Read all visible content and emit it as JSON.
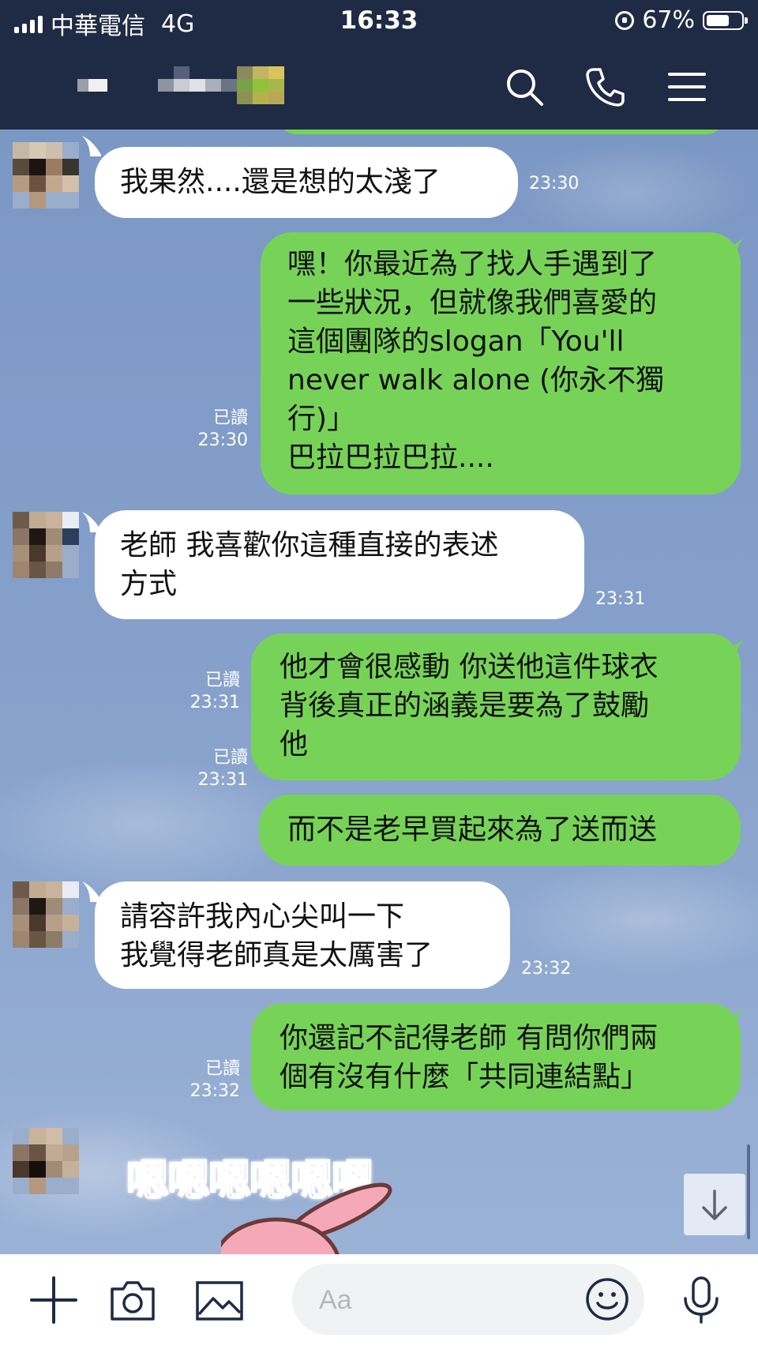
{
  "status_bar": {
    "carrier": "中華電信",
    "network": "4G",
    "time": "16:33",
    "battery": "67%",
    "battery_level": 0.67
  },
  "header": {
    "contact_name_obscured": true,
    "icons": [
      "search-icon",
      "phone-icon",
      "menu-icon"
    ]
  },
  "messages": [
    {
      "side": "in",
      "text": "我果然....還是想的太淺了",
      "time": "23:30"
    },
    {
      "side": "out",
      "text": "嘿！你最近為了找人手遇到了\n一些狀況，但就像我們喜愛的\n這個團隊的slogan「You'll\nnever walk alone (你永不獨\n行)」\n巴拉巴拉巴拉....",
      "read": "已讀",
      "time": "23:30"
    },
    {
      "side": "in",
      "text": "老師 我喜歡你這種直接的表述\n方式",
      "time": "23:31"
    },
    {
      "side": "out",
      "text": "他才會很感動 你送他這件球衣\n背後真正的涵義是要為了鼓勵\n他",
      "read": "已讀",
      "time": "23:31"
    },
    {
      "side": "out",
      "text": "而不是老早買起來為了送而送",
      "read": "已讀",
      "time": "23:31"
    },
    {
      "side": "in",
      "text": "請容許我內心尖叫一下\n我覺得老師真是太厲害了",
      "time": "23:32"
    },
    {
      "side": "out",
      "text": "你還記不記得老師 有問你們兩\n個有沒有什麼「共同連結點」",
      "read": "已讀",
      "time": "23:32"
    }
  ],
  "sticker": {
    "text": "嗯嗯嗯嗯嗯嗯"
  },
  "input": {
    "placeholder": "Aa"
  },
  "colors": {
    "header_bg": "#1f2b44",
    "outgoing_bubble": "#77d357",
    "incoming_bubble": "#ffffff",
    "chat_bg": "#7f9bc6"
  }
}
